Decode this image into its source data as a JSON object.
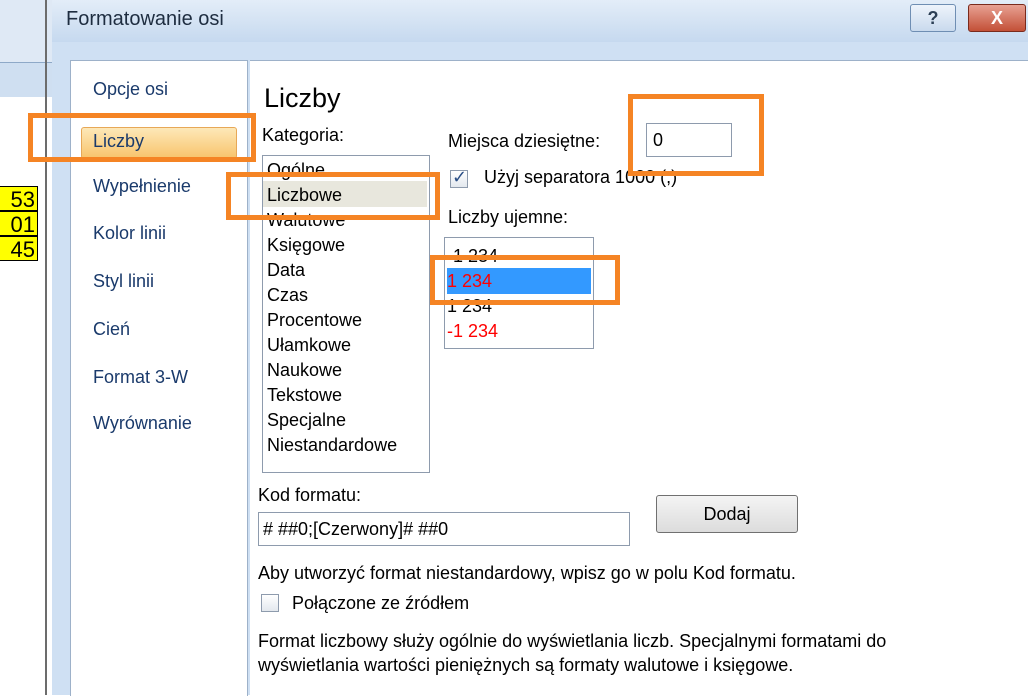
{
  "background_sheet": {
    "cells": [
      "53",
      "01",
      "45"
    ]
  },
  "dialog": {
    "title": "Formatowanie osi",
    "help_label": "?",
    "close_label": "X"
  },
  "nav": {
    "items": [
      {
        "label": "Opcje osi"
      },
      {
        "label": "Liczby"
      },
      {
        "label": "Wypełnienie"
      },
      {
        "label": "Kolor linii"
      },
      {
        "label": "Styl linii"
      },
      {
        "label": "Cień"
      },
      {
        "label": "Format 3-W"
      },
      {
        "label": "Wyrównanie"
      }
    ],
    "selected": "Liczby"
  },
  "content": {
    "heading": "Liczby",
    "category_label": "Kategoria:",
    "categories": [
      "Ogólne",
      "Liczbowe",
      "Walutowe",
      "Księgowe",
      "Data",
      "Czas",
      "Procentowe",
      "Ułamkowe",
      "Naukowe",
      "Tekstowe",
      "Specjalne",
      "Niestandardowe"
    ],
    "selected_category": "Liczbowe",
    "decimal_label": "Miejsca dziesiętne:",
    "decimal_value": "0",
    "separator_label": "Użyj separatora 1000 (,)",
    "separator_checked": true,
    "negative_label": "Liczby ujemne:",
    "negative_options": [
      {
        "text": "-1 234",
        "color": "#000000"
      },
      {
        "text": "1 234",
        "color": "#ff0000"
      },
      {
        "text": "1 234",
        "color": "#000000"
      },
      {
        "text": "-1 234",
        "color": "#ff0000"
      }
    ],
    "format_code_label": "Kod formatu:",
    "format_code_value": "# ##0;[Czerwony]# ##0",
    "add_button_label": "Dodaj",
    "custom_hint": "Aby utworzyć format niestandardowy, wpisz go w polu Kod formatu.",
    "linked_label": "Połączone ze źródłem",
    "linked_checked": false,
    "description_line1": "Format liczbowy służy ogólnie do wyświetlania liczb. Specjalnymi formatami do",
    "description_line2": "wyświetlania wartości pieniężnych są formaty walutowe i księgowe."
  },
  "highlight_color": "#f58424",
  "selection_color": "#3399ff"
}
